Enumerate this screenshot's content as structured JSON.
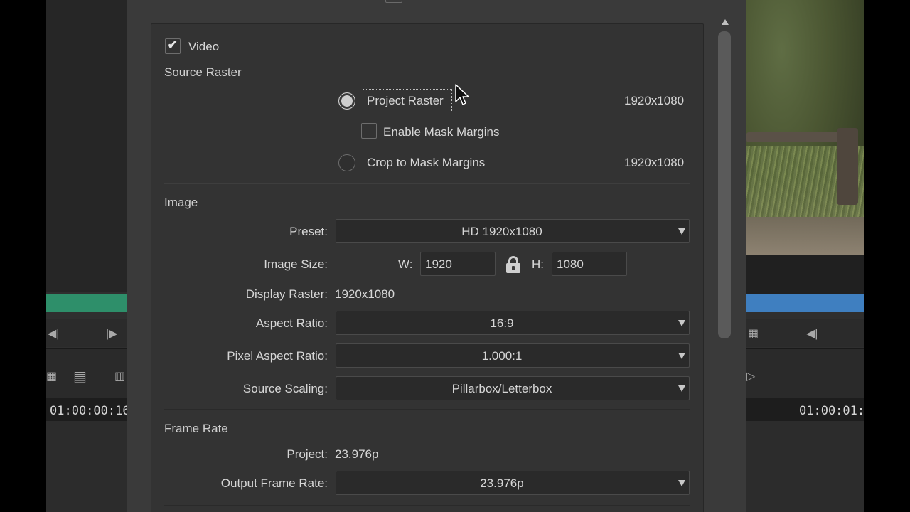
{
  "background": {
    "left_timecode": "01:00:00:16",
    "right_timecode": "01:00:01:"
  },
  "dialog": {
    "video_label": "Video",
    "video_checked": true,
    "source_raster": {
      "heading": "Source Raster",
      "project_raster_label": "Project Raster",
      "project_raster_value": "1920x1080",
      "enable_mask_margins_label": "Enable Mask Margins",
      "crop_to_mask_label": "Crop to Mask Margins",
      "crop_to_mask_value": "1920x1080",
      "selected": "project_raster"
    },
    "image": {
      "heading": "Image",
      "preset_label": "Preset:",
      "preset_value": "HD 1920x1080",
      "image_size_label": "Image Size:",
      "width_label": "W:",
      "width_value": "1920",
      "height_label": "H:",
      "height_value": "1080",
      "display_raster_label": "Display Raster:",
      "display_raster_value": "1920x1080",
      "aspect_ratio_label": "Aspect Ratio:",
      "aspect_ratio_value": "16:9",
      "pixel_aspect_label": "Pixel Aspect Ratio:",
      "pixel_aspect_value": "1.000:1",
      "source_scaling_label": "Source Scaling:",
      "source_scaling_value": "Pillarbox/Letterbox"
    },
    "frame_rate": {
      "heading": "Frame Rate",
      "project_label": "Project:",
      "project_value": "23.976p",
      "output_label": "Output Frame Rate:",
      "output_value": "23.976p"
    }
  },
  "icons": {
    "check": "check-icon",
    "lock": "lock-icon",
    "dropdown": "chevron-down-icon",
    "scroll_up": "arrow-up-icon",
    "cursor": "mouse-pointer-icon"
  },
  "colors": {
    "dialog_bg": "#3a3a3a",
    "panel_bg": "#333333",
    "field_bg": "#2a2a2a",
    "left_clip": "#2e8f6a",
    "right_clip": "#3f7fc0"
  }
}
